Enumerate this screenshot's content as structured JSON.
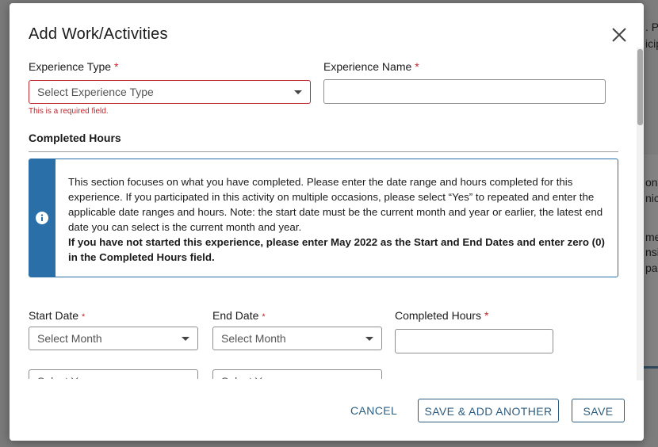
{
  "background": {
    "fragments": [
      ". Pl",
      "icip",
      "on",
      "nich",
      "me",
      "nsic",
      "pac"
    ]
  },
  "modal": {
    "title": "Add Work/Activities",
    "experience_type": {
      "label": "Experience Type",
      "required_mark": "*",
      "placeholder": "Select Experience Type",
      "error": "This is a required field."
    },
    "experience_name": {
      "label": "Experience Name",
      "required_mark": "*",
      "value": ""
    },
    "completed_hours_section": {
      "title": "Completed Hours",
      "info_text": "This section focuses on what you have completed. Please enter the date range and hours completed for this experience. If you participated in this activity on multiple occasions, please select “Yes” to repeated and enter the applicable date ranges and hours. Note: the start date must be the current month and year or earlier, the latest end date you can select is the current month and year.",
      "info_bold": "If you have not started this experience, please enter May 2022 as the Start and End Dates and enter zero (0) in the Completed Hours field."
    },
    "start_date": {
      "label": "Start Date",
      "required_mark": "*",
      "month_placeholder": "Select Month",
      "year_placeholder": "Select Year"
    },
    "end_date": {
      "label": "End Date",
      "required_mark": "*",
      "month_placeholder": "Select Month",
      "year_placeholder": "Select Year"
    },
    "completed_hours": {
      "label": "Completed Hours",
      "required_mark": "*",
      "value": ""
    },
    "footer": {
      "cancel": "CANCEL",
      "save_add_another": "SAVE & ADD ANOTHER",
      "save": "SAVE"
    }
  },
  "colors": {
    "accent": "#2a6fa8",
    "button_text": "#2c5d80",
    "error": "#c0262d"
  }
}
